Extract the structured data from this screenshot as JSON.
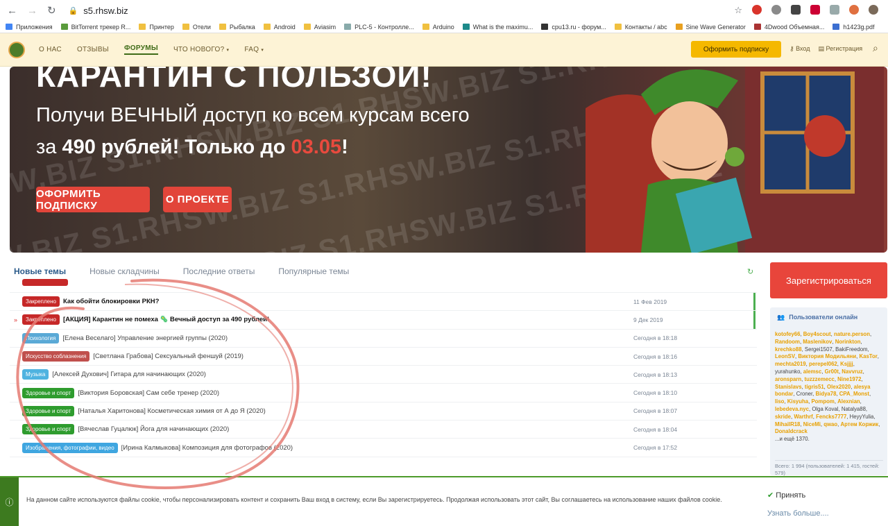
{
  "browser": {
    "url": "s5.rhsw.biz",
    "bookmarks": [
      {
        "label": "Приложения",
        "color": "#4285f4"
      },
      {
        "label": "BitTorrent трекер R...",
        "color": "#5a9b3c"
      },
      {
        "label": "Принтер",
        "color": "#f0c040"
      },
      {
        "label": "Отели",
        "color": "#f0c040"
      },
      {
        "label": "Рыбалка",
        "color": "#f0c040"
      },
      {
        "label": "Android",
        "color": "#f0c040"
      },
      {
        "label": "Aviasim",
        "color": "#f0c040"
      },
      {
        "label": "PLC-5 - Контролле...",
        "color": "#8aa"
      },
      {
        "label": "Arduino",
        "color": "#f0c040"
      },
      {
        "label": "What is the maximu...",
        "color": "#1d8a8a"
      },
      {
        "label": "cpu13.ru - форум...",
        "color": "#333"
      },
      {
        "label": "Контакты / abc",
        "color": "#f0c040"
      },
      {
        "label": "Sine Wave Generator",
        "color": "#e8a020"
      },
      {
        "label": "4Dwood Объемная...",
        "color": "#a33"
      },
      {
        "label": "h1423g.pdf",
        "color": "#3c6fd1"
      }
    ]
  },
  "site": {
    "nav": [
      "О НАС",
      "ОТЗЫВЫ",
      "ФОРУМЫ",
      "ЧТО НОВОГО?",
      "FAQ"
    ],
    "subscribe": "Оформить подписку",
    "login": "Вход",
    "register": "Регистрация"
  },
  "banner": {
    "title": "КАРАНТИН С ПОЛЬЗОЙ!",
    "line1": "Получи ВЕЧНЫЙ доступ ко всем курсам всего",
    "line2_pre": "за ",
    "line2_bold": "490 рублей! Только до ",
    "line2_date": "03.05",
    "line2_end": "!",
    "btn_subscribe": "ОФОРМИТЬ ПОДПИСКУ",
    "btn_about": "О ПРОЕКТЕ",
    "watermark": "SW.BIZ S1.RHSW.BIZ S1.RHSW.BIZ S1.RHSW.BIZ"
  },
  "tabs": [
    "Новые темы",
    "Новые складчины",
    "Последние ответы",
    "Популярные темы"
  ],
  "threads": [
    {
      "tag": "",
      "tag_color": "#c62828",
      "title": "",
      "date": "",
      "bold": false
    },
    {
      "tag": "Закреплено",
      "tag_color": "#c62828",
      "title": "Как обойти блокировки РКН?",
      "date": "11 Фев 2019",
      "bold": true
    },
    {
      "tag": "Закреплено",
      "tag_color": "#c62828",
      "title": "[АКЦИЯ] Карантин не помеха 🦠 Вечный доступ за 490 рублей!",
      "date": "9 Дек 2019",
      "bold": true
    },
    {
      "tag": "Психология",
      "tag_color": "#5aa9d6",
      "title": "[Елена Веселаго] Управление энергией группы (2020)",
      "date": "Сегодня в 18:18",
      "bold": false
    },
    {
      "tag": "Искусство соблазнения",
      "tag_color": "#c0504d",
      "title": "[Светлана Грабова] Сексуальный феншуй (2019)",
      "date": "Сегодня в 18:16",
      "bold": false
    },
    {
      "tag": "Музыка",
      "tag_color": "#4fb3e0",
      "title": "[Алексей Духович] Гитара для начинающих (2020)",
      "date": "Сегодня в 18:13",
      "bold": false
    },
    {
      "tag": "Здоровье и спорт",
      "tag_color": "#2e9c2e",
      "title": "[Виктория Боровская] Сам себе тренер (2020)",
      "date": "Сегодня в 18:10",
      "bold": false
    },
    {
      "tag": "Здоровье и спорт",
      "tag_color": "#2e9c2e",
      "title": "[Наталья Харитонова] Косметическая химия от А до Я (2020)",
      "date": "Сегодня в 18:07",
      "bold": false
    },
    {
      "tag": "Здоровье и спорт",
      "tag_color": "#2e9c2e",
      "title": "[Вячеслав Гуцалюк] Йога для начинающих (2020)",
      "date": "Сегодня в 18:04",
      "bold": false
    },
    {
      "tag": "Изображения, фотографии, видео",
      "tag_color": "#3fa6e0",
      "title": "[Ирина Калмыкова] Композиция для фотографов (2020)",
      "date": "Сегодня в 17:52",
      "bold": false
    }
  ],
  "sidebar": {
    "register": "Зарегистрироваться",
    "online_title": "Пользователи онлайн",
    "users": [
      {
        "n": "kotofey66",
        "h": true
      },
      {
        "n": "Boy4scout",
        "h": true
      },
      {
        "n": "nature.person",
        "h": true
      },
      {
        "n": "Randoom",
        "h": true
      },
      {
        "n": "Maslenikov",
        "h": true
      },
      {
        "n": "Norinkton",
        "h": true
      },
      {
        "n": "krechko88",
        "h": true
      },
      {
        "n": "Sergei1507",
        "h": false
      },
      {
        "n": "BakiFreedom",
        "h": false
      },
      {
        "n": "LeonSV",
        "h": true
      },
      {
        "n": "Виктория Модильяни",
        "h": true
      },
      {
        "n": "KasTor",
        "h": true
      },
      {
        "n": "mechta2019",
        "h": true
      },
      {
        "n": "perepel062",
        "h": true
      },
      {
        "n": "Ksjjjj",
        "h": true
      },
      {
        "n": "yurahunko",
        "h": false
      },
      {
        "n": "alemsc",
        "h": true
      },
      {
        "n": "Gr00t",
        "h": true
      },
      {
        "n": "Navvruz",
        "h": true
      },
      {
        "n": "aronsparn",
        "h": true
      },
      {
        "n": "tuzzzemecc",
        "h": true
      },
      {
        "n": "Nine1972",
        "h": true
      },
      {
        "n": "Stanislavs",
        "h": true
      },
      {
        "n": "tigris51",
        "h": true
      },
      {
        "n": "Olex2020",
        "h": true
      },
      {
        "n": "alesya bondar",
        "h": true
      },
      {
        "n": "Croner",
        "h": false
      },
      {
        "n": "Bidya78",
        "h": true
      },
      {
        "n": "CPA_Monst",
        "h": true
      },
      {
        "n": "liso",
        "h": true
      },
      {
        "n": "Kisyuha",
        "h": true
      },
      {
        "n": "Pompom",
        "h": true
      },
      {
        "n": "Alexnian",
        "h": true
      },
      {
        "n": "lebedeva.nyc",
        "h": true
      },
      {
        "n": "Olga Koval",
        "h": false
      },
      {
        "n": "Natalya88",
        "h": false
      },
      {
        "n": "skride",
        "h": true
      },
      {
        "n": "Warthrf",
        "h": true
      },
      {
        "n": "Fencks7777",
        "h": true
      },
      {
        "n": "HeyyYulia",
        "h": false
      },
      {
        "n": "MihailR18",
        "h": true
      },
      {
        "n": "NiceMi",
        "h": true
      },
      {
        "n": "qwao",
        "h": true
      },
      {
        "n": "Артем Коржик",
        "h": true
      },
      {
        "n": "Donaldcrack",
        "h": true
      }
    ],
    "more": "...и ещё 1370.",
    "totals": "Всего: 1 994 (пользователей: 1 415, гостей: 579)"
  },
  "cookie": {
    "text": "На данном сайте используются файлы cookie, чтобы персонализировать контент и сохранить Ваш вход в систему, если Вы зарегистрируетесь. Продолжая использовать этот сайт, Вы соглашаетесь на использование наших файлов cookie.",
    "accept": "Принять",
    "more": "Узнать больше...."
  }
}
